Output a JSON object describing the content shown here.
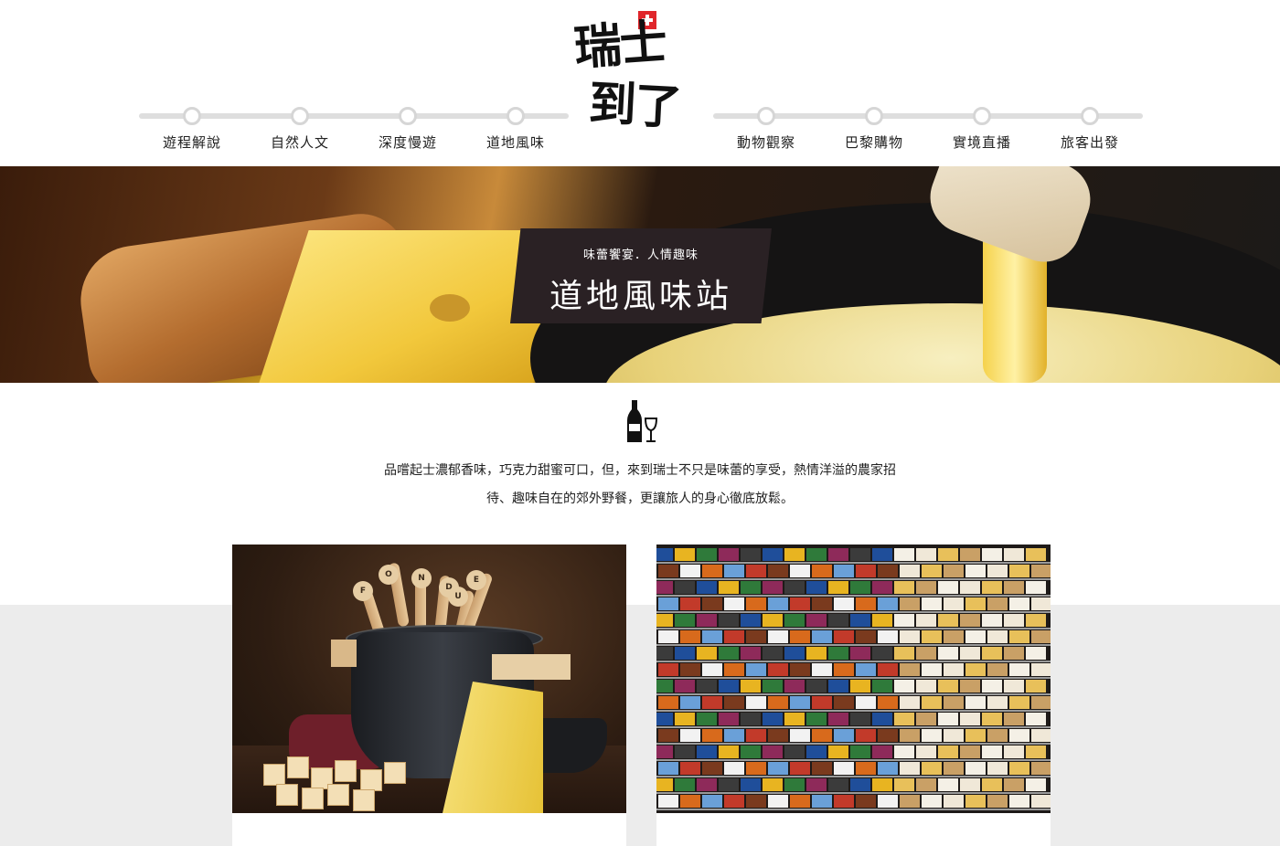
{
  "nav": {
    "left": [
      {
        "label": "遊程解說"
      },
      {
        "label": "自然人文"
      },
      {
        "label": "深度慢遊"
      },
      {
        "label": "道地風味"
      }
    ],
    "right": [
      {
        "label": "動物觀察"
      },
      {
        "label": "巴黎購物"
      },
      {
        "label": "實境直播"
      },
      {
        "label": "旅客出發"
      }
    ]
  },
  "logo": {
    "line1": "瑞士",
    "line2": "到了",
    "flag_icon": "swiss-flag-icon"
  },
  "hero": {
    "subtitle": "味蕾饗宴．人情趣味",
    "title": "道地風味站"
  },
  "intro": {
    "icon": "wine-bottle-glass-icon",
    "text": "品嚐起士濃郁香味，巧克力甜蜜可口，但，來到瑞士不只是味蕾的享受，熱情洋溢的農家招待、趣味自在的郊外野餐，更讓旅人的身心徹底放鬆。"
  },
  "cards": [
    {
      "image": "fondue-pot-photo",
      "fork_letters": [
        "F",
        "O",
        "N",
        "D",
        "U",
        "E"
      ]
    },
    {
      "image": "chocolate-shelf-photo"
    }
  ],
  "colors": {
    "accent": "#2a2124",
    "track": "#dedede",
    "band": "#ececec",
    "flag": "#e0262b"
  }
}
